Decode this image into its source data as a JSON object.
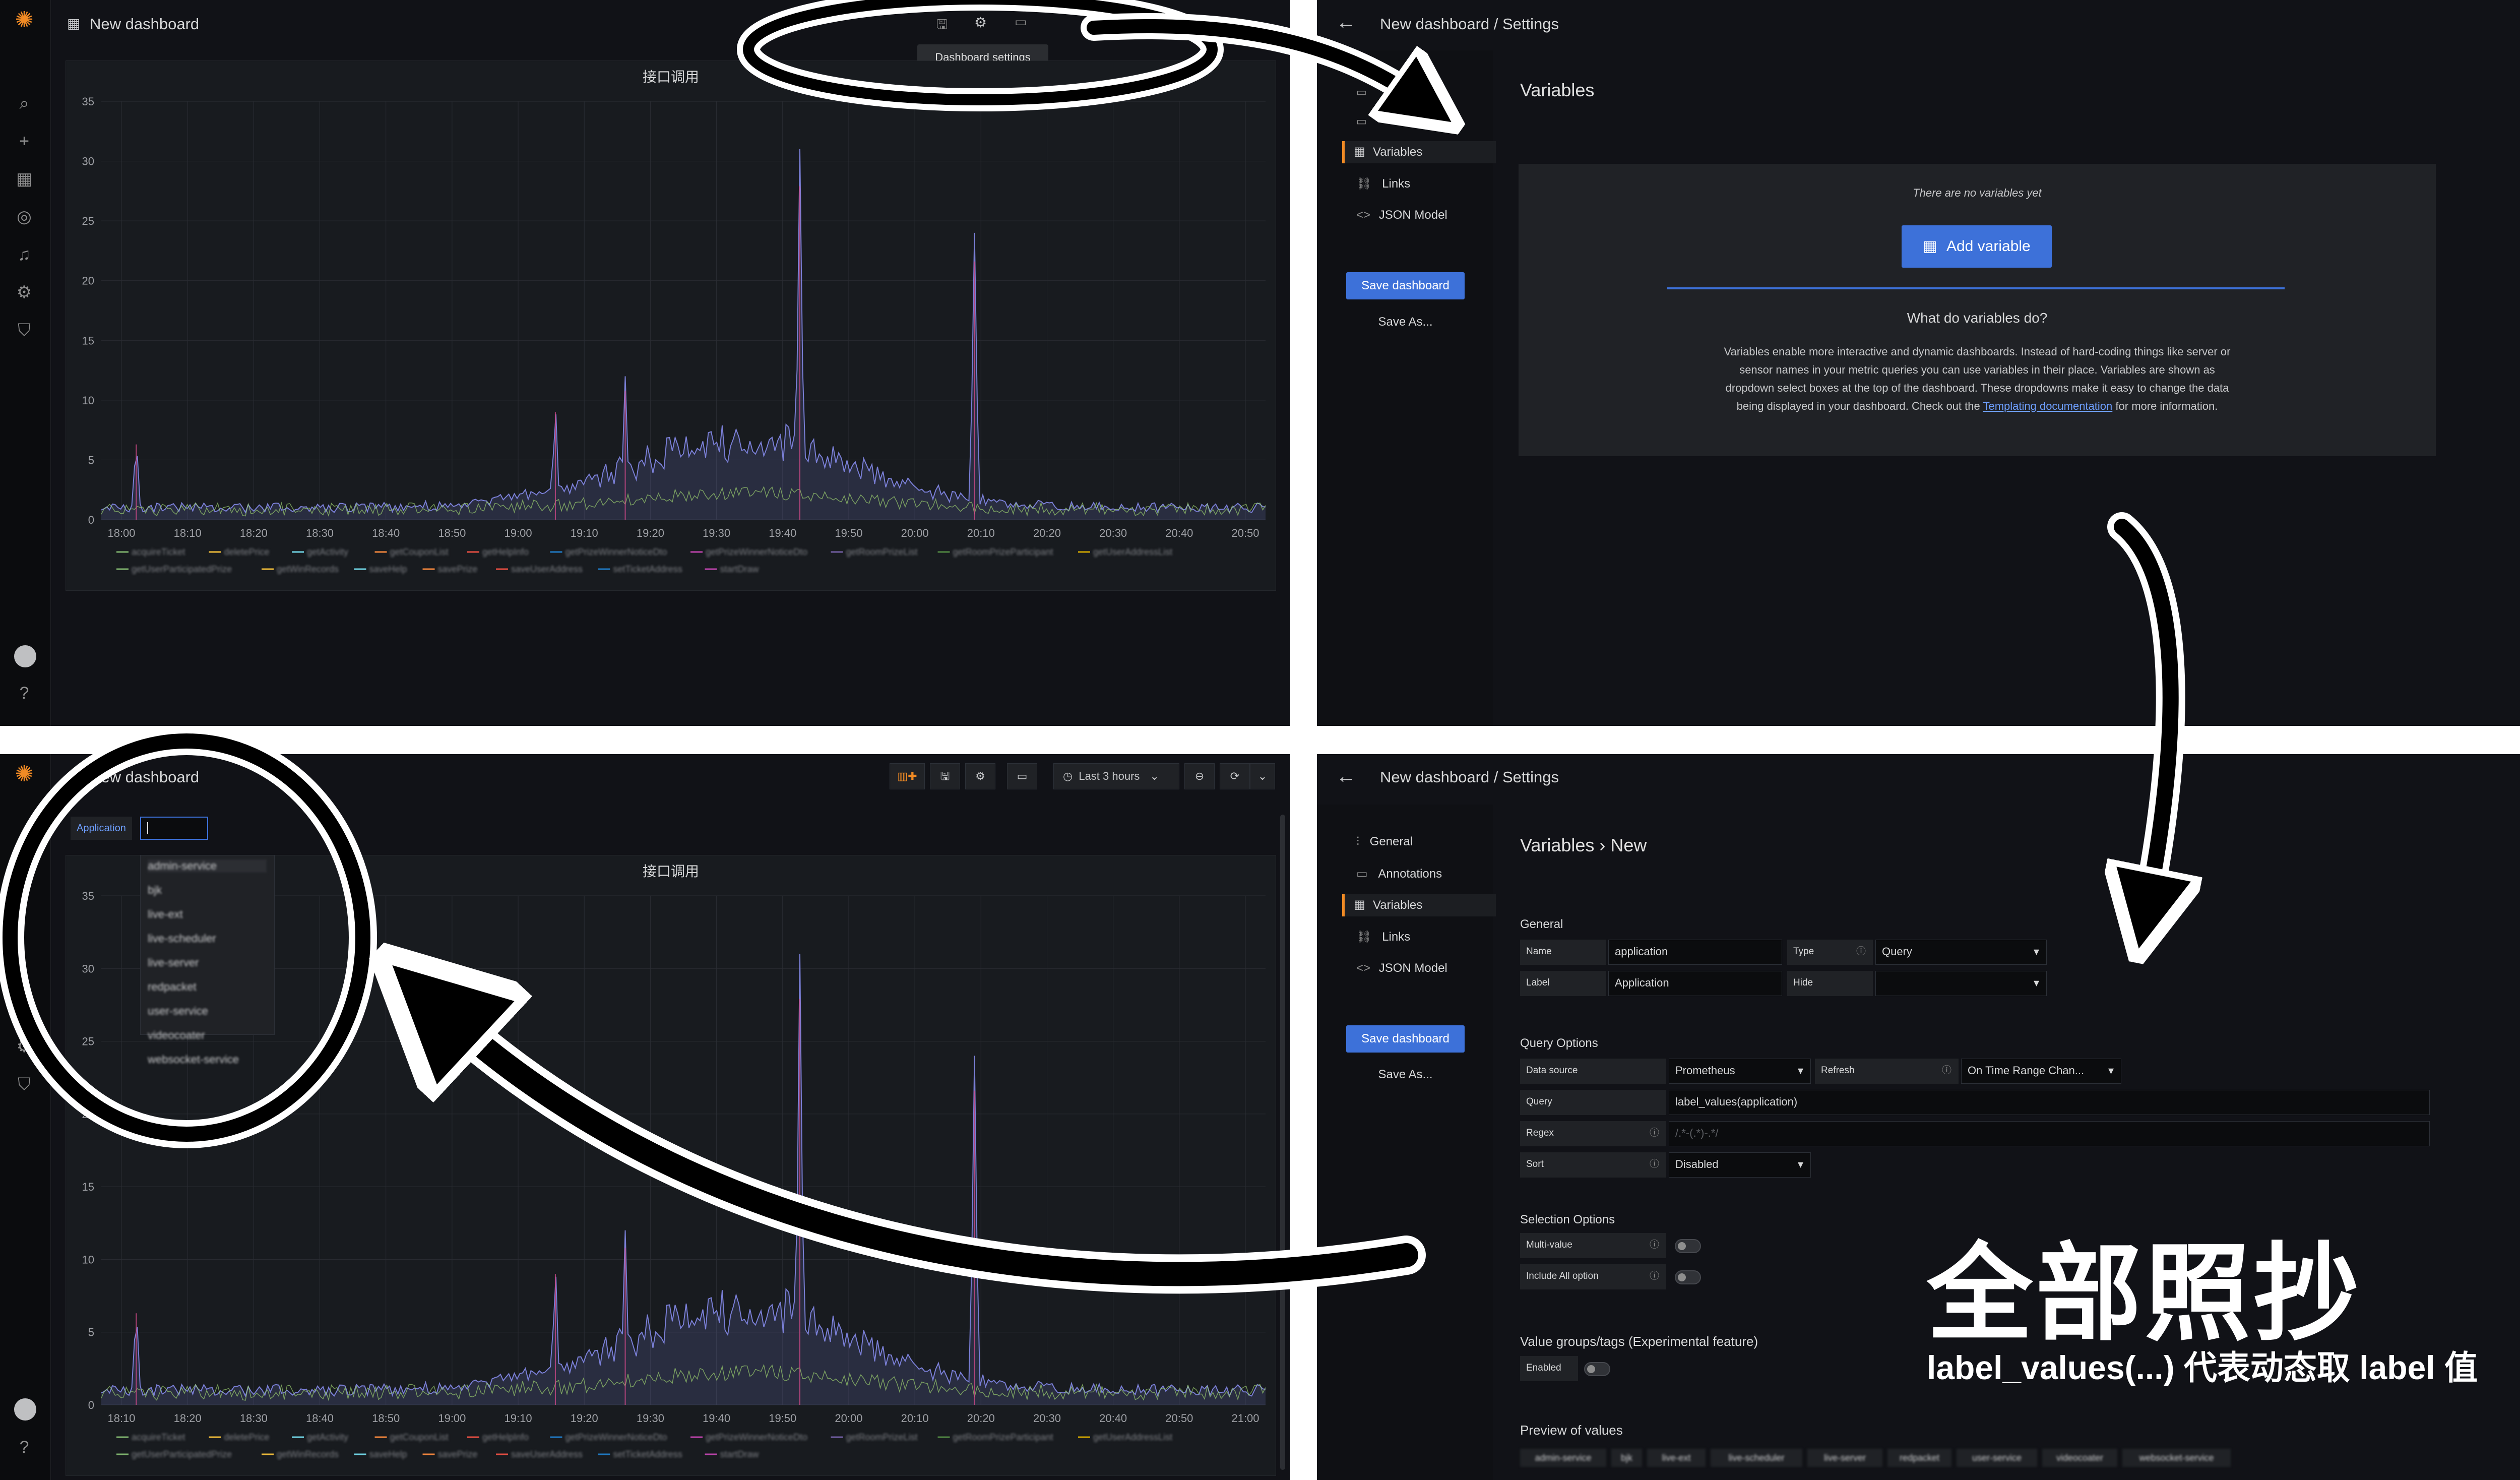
{
  "q1": {
    "title": "New dashboard",
    "tooltip": "Dashboard settings",
    "panel_title": "接口调用"
  },
  "q2": {
    "breadcrumb": "New dashboard / Settings",
    "page_title": "Variables",
    "nav": [
      "Variables",
      "Links",
      "JSON Model"
    ],
    "save": "Save dashboard",
    "save_as": "Save As...",
    "empty": "There are no variables yet",
    "add": "Add variable",
    "what_title": "What do variables do?",
    "desc_1": "Variables enable more interactive and dynamic dashboards. Instead of hard-coding things like server or",
    "desc_2": "sensor names in your metric queries you can use variables in their place. Variables are shown as",
    "desc_3": "dropdown select boxes at the top of the dashboard. These dropdowns make it easy to change the data",
    "desc_4a": "being displayed in your dashboard. Check out the",
    "desc_link": "Templating documentation",
    "desc_4b": "for more information."
  },
  "q3": {
    "title": "New dashboard",
    "var_label": "Application",
    "time_range": "Last 3 hours",
    "panel_title": "接口调用",
    "dropdown": [
      "admin-service",
      "bjk",
      "live-ext",
      "live-scheduler",
      "live-server",
      "redpacket",
      "user-service",
      "videocoater",
      "websocket-service"
    ]
  },
  "q4": {
    "breadcrumb": "New dashboard / Settings",
    "page_title": "Variables › New",
    "nav": [
      "General",
      "Annotations",
      "Variables",
      "Links",
      "JSON Model"
    ],
    "save": "Save dashboard",
    "save_as": "Save As...",
    "general": "General",
    "name_label": "Name",
    "name_value": "application",
    "type_label": "Type",
    "type_value": "Query",
    "label_label": "Label",
    "label_value": "Application",
    "hide_label": "Hide",
    "hide_value": "",
    "query_options": "Query Options",
    "ds_label": "Data source",
    "ds_value": "Prometheus",
    "refresh_label": "Refresh",
    "refresh_value": "On Time Range Chan...",
    "query_label": "Query",
    "query_value": "label_values(application)",
    "regex_label": "Regex",
    "regex_placeholder": "/.*-(.*)-.*/",
    "sort_label": "Sort",
    "sort_value": "Disabled",
    "selection_options": "Selection Options",
    "multi": "Multi-value",
    "include_all": "Include All option",
    "value_groups": "Value groups/tags (Experimental feature)",
    "enabled": "Enabled",
    "preview": "Preview of values",
    "preview_values": [
      "admin-service",
      "bjk",
      "live-ext",
      "live-scheduler",
      "live-server",
      "redpacket",
      "user-service",
      "videocoater",
      "websocket-service"
    ]
  },
  "chart_top": {
    "type": "line",
    "title": "接口调用",
    "yticks": [
      "35",
      "30",
      "25",
      "20",
      "15",
      "10",
      "5",
      "0"
    ],
    "xticks": [
      "18:00",
      "18:10",
      "18:20",
      "18:30",
      "18:40",
      "18:50",
      "19:00",
      "19:10",
      "19:20",
      "19:30",
      "19:40",
      "19:50",
      "20:00",
      "20:10",
      "20:20",
      "20:30",
      "20:40",
      "20:50"
    ],
    "legend_1": [
      "acquireTicket",
      "deletePrice",
      "getActivity",
      "getCouponList",
      "getHelpInfo",
      "getPrizeWinnerNoticeDto",
      "getPrizeWinnerNoticeDto",
      "getRoomPrizeList",
      "getRoomPrizeParticipant",
      "getUserAddressList"
    ],
    "legend_2": [
      "getUserParticipatedPrize",
      "getWinRecords",
      "saveHelp",
      "savePrize",
      "saveUserAddress",
      "setTicketAddress",
      "startDraw"
    ],
    "ylim": [
      0,
      35
    ]
  },
  "chart_bottom": {
    "type": "line",
    "title": "接口调用",
    "yticks": [
      "35",
      "30",
      "25",
      "20",
      "15",
      "10",
      "5",
      "0"
    ],
    "xticks": [
      "18:10",
      "18:20",
      "18:30",
      "18:40",
      "18:50",
      "19:00",
      "19:10",
      "19:20",
      "19:30",
      "19:40",
      "19:50",
      "20:00",
      "20:10",
      "20:20",
      "20:30",
      "20:40",
      "20:50",
      "21:00"
    ],
    "legend_1": [
      "acquireTicket",
      "deletePrice",
      "getActivity",
      "getCouponList",
      "getHelpInfo",
      "getPrizeWinnerNoticeDto",
      "getPrizeWinnerNoticeDto",
      "getRoomPrizeList",
      "getRoomPrizeParticipant",
      "getUserAddressList"
    ],
    "legend_2": [
      "getUserParticipatedPrize",
      "getWinRecords",
      "saveHelp",
      "savePrize",
      "saveUserAddress",
      "setTicketAddress",
      "startDraw"
    ],
    "ylim": [
      0,
      35
    ]
  },
  "annotation": {
    "big": "全部照抄",
    "small": "label_values(...) 代表动态取 label 值"
  },
  "colors": {
    "accent": "#3d71d9",
    "orange": "#f08a24",
    "series": "#7a7fd6"
  }
}
